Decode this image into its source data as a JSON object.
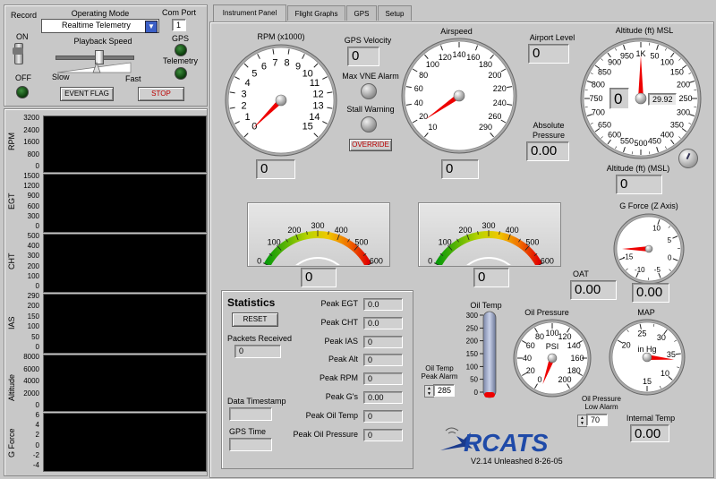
{
  "left_top": {
    "record_label": "Record",
    "on_label": "ON",
    "off_label": "OFF",
    "operating_mode_label": "Operating Mode",
    "operating_mode_value": "Realtime Telemetry",
    "playback_label": "Playback Speed",
    "slow_label": "Slow",
    "fast_label": "Fast",
    "com_port_label": "Com Port",
    "com_port_value": "1",
    "gps_label": "GPS",
    "telemetry_label": "Telemetry",
    "event_flag_label": "EVENT FLAG",
    "stop_label": "STOP"
  },
  "strips": [
    {
      "name": "RPM",
      "ticks": [
        "3200",
        "2400",
        "1600",
        "800",
        "0"
      ]
    },
    {
      "name": "EGT",
      "ticks": [
        "1500",
        "1200",
        "900",
        "600",
        "300",
        "0"
      ]
    },
    {
      "name": "CHT",
      "ticks": [
        "500",
        "400",
        "300",
        "200",
        "100",
        "0"
      ]
    },
    {
      "name": "IAS",
      "ticks": [
        "290",
        "200",
        "150",
        "100",
        "50",
        "0"
      ]
    },
    {
      "name": "Altitude",
      "ticks": [
        "8000",
        "6000",
        "4000",
        "2000",
        "0"
      ]
    },
    {
      "name": "G Force",
      "ticks": [
        "6",
        "4",
        "2",
        "0",
        "-2",
        "-4"
      ]
    }
  ],
  "tabs": [
    "Instrument Panel",
    "Flight Graphs",
    "GPS",
    "Setup"
  ],
  "rpm": {
    "title": "RPM (x1000)",
    "ticks": [
      "0",
      "1",
      "2",
      "3",
      "4",
      "5",
      "6",
      "7",
      "8",
      "9",
      "10",
      "11",
      "12",
      "13",
      "14",
      "15"
    ],
    "value": "0",
    "needle": 0.5
  },
  "gps_velocity": {
    "label": "GPS Velocity",
    "value": "0"
  },
  "vne": {
    "label": "Max VNE Alarm"
  },
  "stall": {
    "label": "Stall Warning"
  },
  "override_label": "OVERRIDE",
  "airspeed": {
    "title": "Airspeed",
    "ticks": [
      "10",
      "20",
      "40",
      "60",
      "80",
      "100",
      "120",
      "140",
      "160",
      "180",
      "200",
      "220",
      "240",
      "260",
      "290"
    ],
    "value": "0",
    "needle": 10
  },
  "airport_level": {
    "label": "Airport Level",
    "value": "0"
  },
  "abs_pressure": {
    "label1": "Absolute",
    "label2": "Pressure",
    "value": "0.00"
  },
  "altitude": {
    "title": "Altitude (ft) MSL",
    "ticks": [
      "1K",
      "50",
      "100",
      "150",
      "200",
      "250",
      "300",
      "350",
      "400",
      "450",
      "500",
      "550",
      "600",
      "650",
      "700",
      "750",
      "800",
      "850",
      "900",
      "950"
    ],
    "counter": "0",
    "baro": "29.92",
    "label": "Altitude (ft) (MSL)",
    "value": "0"
  },
  "egt_gauge": {
    "ticks": [
      "0",
      "100",
      "200",
      "300",
      "400",
      "500",
      "600"
    ],
    "value": "0"
  },
  "cht_gauge": {
    "ticks": [
      "0",
      "100",
      "200",
      "300",
      "400",
      "500",
      "600"
    ],
    "value": "0"
  },
  "gforce": {
    "title": "G Force (Z Axis)",
    "ticks": [
      "10",
      "5",
      "0",
      "-5",
      "-10",
      "-15"
    ],
    "value": "0.00"
  },
  "oat": {
    "label": "OAT",
    "value": "0.00"
  },
  "statistics": {
    "title": "Statistics",
    "reset_label": "RESET",
    "packets_label": "Packets Received",
    "packets_value": "0",
    "timestamp_label": "Data Timestamp",
    "gps_time_label": "GPS Time",
    "peaks": [
      {
        "label": "Peak EGT",
        "value": "0.0"
      },
      {
        "label": "Peak CHT",
        "value": "0.0"
      },
      {
        "label": "Peak IAS",
        "value": "0"
      },
      {
        "label": "Peak Alt",
        "value": "0"
      },
      {
        "label": "Peak RPM",
        "value": "0"
      },
      {
        "label": "Peak G's",
        "value": "0.00"
      },
      {
        "label": "Peak Oil Temp",
        "value": "0"
      },
      {
        "label": "Peak Oil Pressure",
        "value": "0"
      }
    ]
  },
  "oil_temp": {
    "title": "Oil Temp",
    "ticks": [
      "300",
      "250",
      "200",
      "150",
      "100",
      "50",
      "0"
    ],
    "alarm_label1": "Oil Temp",
    "alarm_label2": "Peak Alarm",
    "alarm_value": "285"
  },
  "oil_pressure": {
    "title": "Oil Pressure",
    "unit": "PSI",
    "ticks": [
      "0",
      "20",
      "40",
      "60",
      "80",
      "100",
      "120",
      "140",
      "160",
      "180",
      "200"
    ],
    "alarm_label1": "Oil Pressure",
    "alarm_label2": "Low Alarm",
    "alarm_value": "70"
  },
  "map": {
    "title": "MAP",
    "unit": "in Hg",
    "ticks": [
      "20",
      "25",
      "30",
      "35",
      "10",
      "15"
    ]
  },
  "internal_temp": {
    "label": "Internal Temp",
    "value": "0.00"
  },
  "brand": {
    "name": "RCATS",
    "version": "V2.14 Unleashed 8-26-05"
  }
}
